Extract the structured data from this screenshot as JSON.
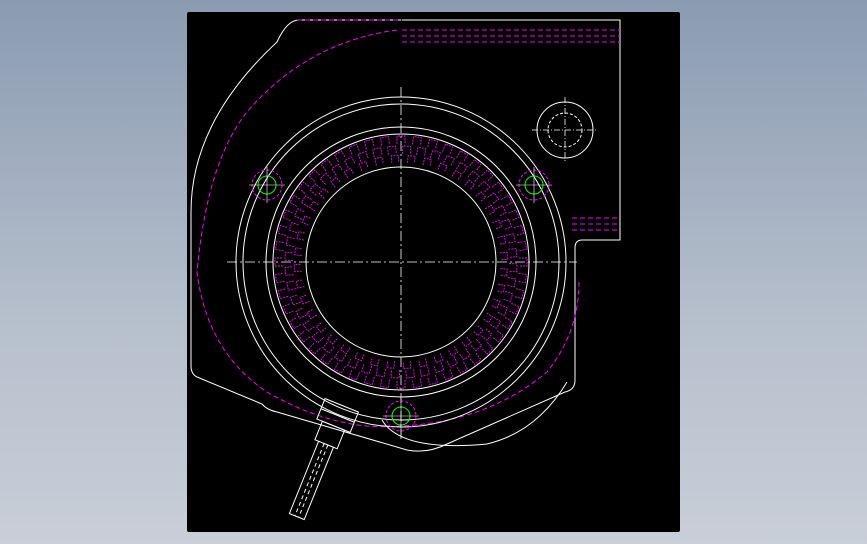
{
  "viewer": {
    "background": "#000000",
    "frame_background_top": "#8a9bb1",
    "frame_background_bottom": "#c9ced8"
  },
  "colors": {
    "outline": "#ffffff",
    "hidden_line": "#ff00ff",
    "hole_marker": "#00ff00",
    "centerline": "#ffffff"
  },
  "drawing": {
    "view": "top-view",
    "ring_slot_count_outer": 48,
    "ring_slot_count_inner": 40,
    "mounting_hole_count": 3
  }
}
